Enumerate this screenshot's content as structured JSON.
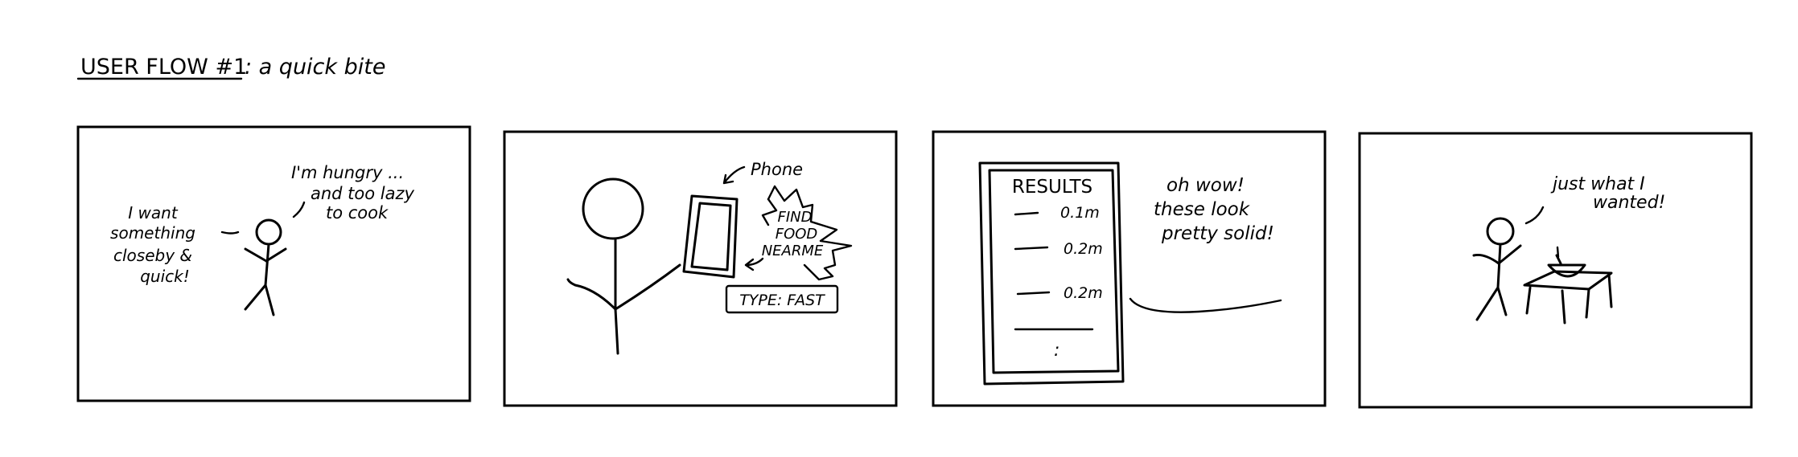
{
  "title": {
    "underlined": "USER FLOW #1",
    "rest": ": a quick bite"
  },
  "panels": [
    {
      "speech_right": [
        "I'm hungry ...",
        "and too lazy",
        "to cook"
      ],
      "speech_left": [
        "I want",
        "something",
        "closeby &",
        "quick!"
      ]
    },
    {
      "phone_label": "Phone",
      "burst": [
        "FIND",
        "FOOD",
        "NEARME"
      ],
      "tag": "TYPE: FAST"
    },
    {
      "results_title": "RESULTS",
      "results": [
        "0.1m",
        "0.2m",
        "0.2m"
      ],
      "more": ":",
      "speech": [
        "oh wow!",
        "these look",
        "pretty solid!"
      ]
    },
    {
      "speech": [
        "just what I",
        "wanted!"
      ]
    }
  ]
}
